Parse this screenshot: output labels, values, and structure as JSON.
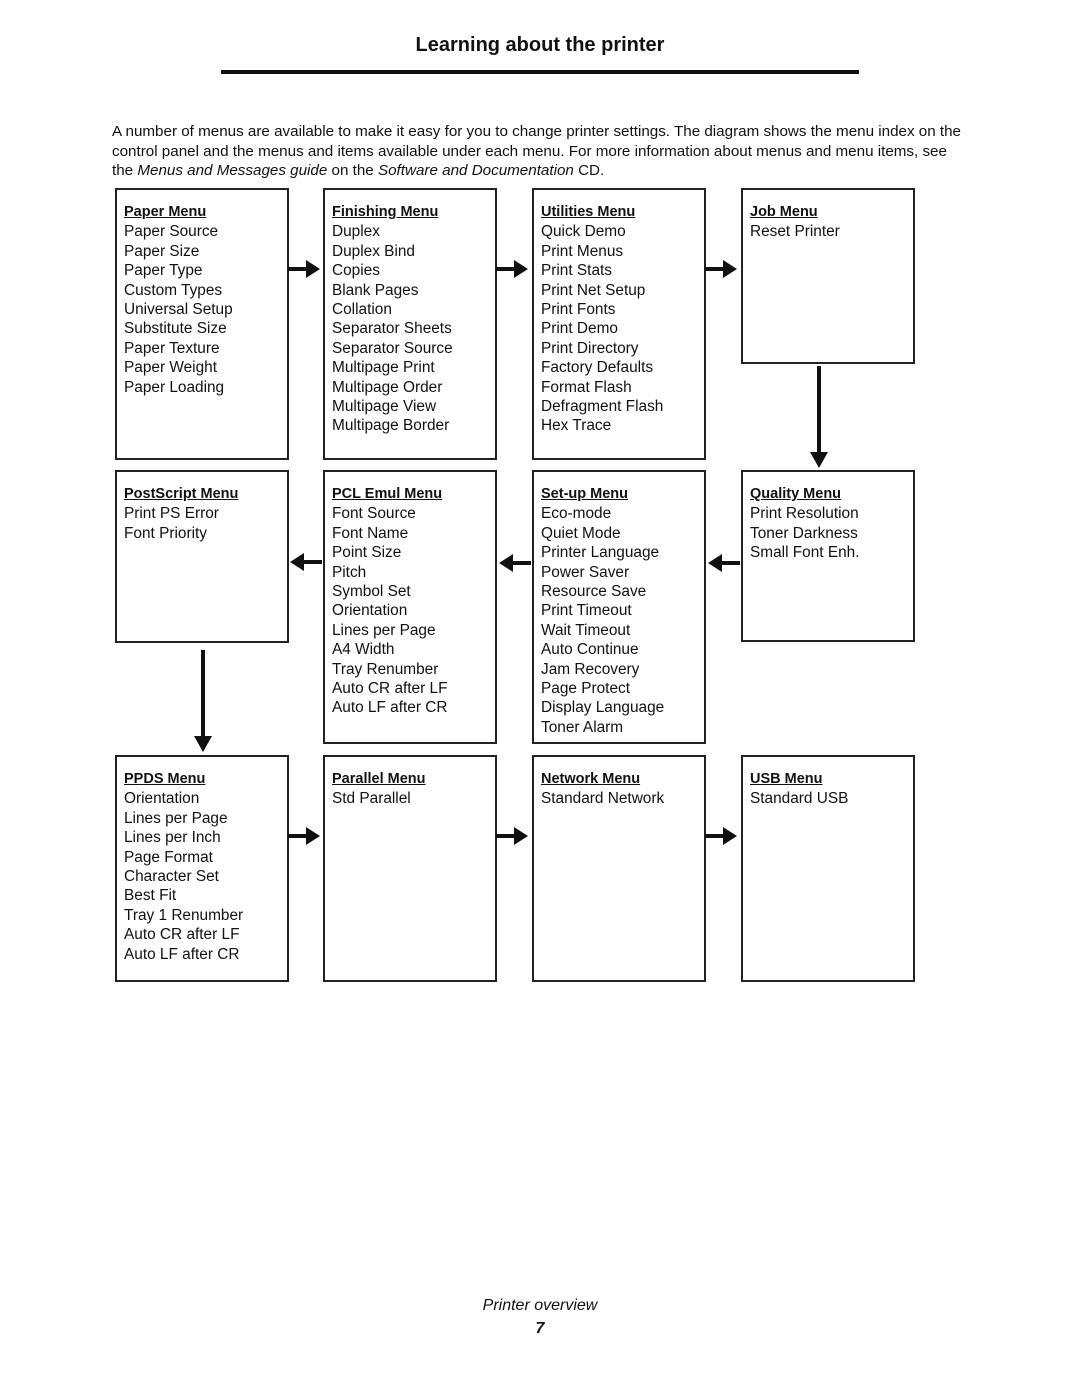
{
  "page": {
    "title": "Learning about the printer",
    "intro": {
      "part1": "A number of menus are available to make it easy for you to change printer settings. The diagram shows the menu index on the control panel and the menus and items available under each menu. For more information about menus and menu items, see the ",
      "italic1": "Menus and Messages guide",
      "part2": " on the ",
      "italic2": "Software and Documentation",
      "part3": " CD."
    },
    "footer": {
      "section": "Printer overview",
      "page_number": "7"
    }
  },
  "menus": [
    {
      "title": "Paper Menu",
      "items": [
        "Paper Source",
        "Paper Size",
        "Paper Type",
        "Custom Types",
        "Universal Setup",
        "Substitute Size",
        "Paper Texture",
        "Paper Weight",
        "Paper Loading"
      ]
    },
    {
      "title": "Finishing Menu",
      "items": [
        "Duplex",
        "Duplex Bind",
        "Copies",
        "Blank Pages",
        "Collation",
        "Separator Sheets",
        "Separator Source",
        "Multipage Print",
        "Multipage Order",
        "Multipage View",
        "Multipage Border"
      ]
    },
    {
      "title": "Utilities Menu",
      "items": [
        "Quick Demo",
        "Print Menus",
        "Print Stats",
        "Print Net Setup",
        "Print Fonts",
        "Print Demo",
        "Print Directory",
        "Factory Defaults",
        "Format Flash",
        "Defragment Flash",
        "Hex Trace"
      ]
    },
    {
      "title": "Job Menu",
      "items": [
        "Reset Printer"
      ]
    },
    {
      "title": "PostScript Menu",
      "items": [
        "Print PS Error",
        "Font Priority"
      ]
    },
    {
      "title": "PCL Emul Menu",
      "items": [
        "Font Source",
        "Font Name",
        "Point Size",
        "Pitch",
        "Symbol Set",
        "Orientation",
        "Lines per Page",
        "A4 Width",
        "Tray Renumber",
        "Auto CR after LF",
        "Auto LF after CR"
      ]
    },
    {
      "title": "Set-up Menu",
      "items": [
        "Eco-mode",
        "Quiet Mode",
        "Printer Language",
        "Power Saver",
        "Resource Save",
        "Print Timeout",
        "Wait Timeout",
        "Auto Continue",
        "Jam Recovery",
        "Page Protect",
        "Display Language",
        "Toner Alarm"
      ]
    },
    {
      "title": "Quality Menu",
      "items": [
        "Print Resolution",
        "Toner Darkness",
        "Small Font Enh."
      ]
    },
    {
      "title": "PPDS Menu",
      "items": [
        "Orientation",
        "Lines per Page",
        "Lines per Inch",
        "Page Format",
        "Character Set",
        "Best Fit",
        "Tray 1 Renumber",
        "Auto CR after LF",
        "Auto LF after CR"
      ]
    },
    {
      "title": "Parallel Menu",
      "items": [
        "Std Parallel"
      ]
    },
    {
      "title": "Network Menu",
      "items": [
        "Standard Network"
      ]
    },
    {
      "title": "USB Menu",
      "items": [
        "Standard USB"
      ]
    }
  ],
  "flow": [
    {
      "from": "Paper Menu",
      "to": "Finishing Menu",
      "direction": "right"
    },
    {
      "from": "Finishing Menu",
      "to": "Utilities Menu",
      "direction": "right"
    },
    {
      "from": "Utilities Menu",
      "to": "Job Menu",
      "direction": "right"
    },
    {
      "from": "Job Menu",
      "to": "Quality Menu",
      "direction": "down"
    },
    {
      "from": "Quality Menu",
      "to": "Set-up Menu",
      "direction": "left"
    },
    {
      "from": "Set-up Menu",
      "to": "PCL Emul Menu",
      "direction": "left"
    },
    {
      "from": "PCL Emul Menu",
      "to": "PostScript Menu",
      "direction": "left"
    },
    {
      "from": "PostScript Menu",
      "to": "PPDS Menu",
      "direction": "down"
    },
    {
      "from": "PPDS Menu",
      "to": "Parallel Menu",
      "direction": "right"
    },
    {
      "from": "Parallel Menu",
      "to": "Network Menu",
      "direction": "right"
    },
    {
      "from": "Network Menu",
      "to": "USB Menu",
      "direction": "right"
    }
  ]
}
